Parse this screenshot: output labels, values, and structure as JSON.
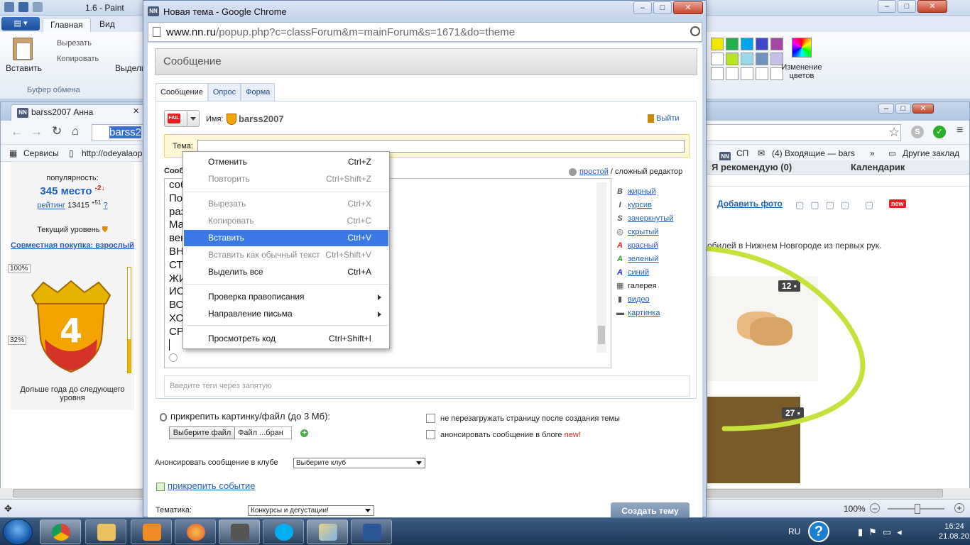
{
  "paint": {
    "title": "1.6 - Paint",
    "menu_label": "",
    "tabs": [
      "Главная",
      "Вид"
    ],
    "cut": "Вырезать",
    "copy": "Копировать",
    "paste": "Вставить",
    "select": "Выдели",
    "clipboard_group": "Буфер обмена",
    "edit_colors": "Изменение цветов",
    "palette": [
      "#f2e600",
      "#22b14c",
      "#00a2e8",
      "#3f48cc",
      "#a349a4",
      "#ffffff",
      "#b5e61d",
      "#99d9ea",
      "#7092be",
      "#c8bfe7",
      "#ffffff",
      "#ffffff",
      "#ffffff",
      "#ffffff",
      "#ffffff"
    ],
    "zoom": "100%"
  },
  "browser": {
    "tab_title": "barss2007 Анна",
    "url_selected": "barss2",
    "bookmarks": {
      "services": "Сервисы",
      "odeyalo": "http://odeyalaop",
      "nn": "СП",
      "inbox": "(4) Входящие — bars",
      "other": "Другие заклад"
    },
    "left": {
      "popularity_label": "популярность:",
      "rank": "345 место",
      "rank_delta": "-2↓",
      "rating_link": "рейтинг",
      "rating_value": "13415",
      "rating_delta": "+51",
      "rating_q": "?",
      "level_label": "Текущий уровень",
      "joint": "Совместная покупка: взрослый",
      "pct_top": "100%",
      "pct_fill": "32%",
      "fill_fraction": 0.32,
      "shield_level": "4",
      "next_level": "Дольше года до следующего уровня"
    },
    "right": {
      "recommend": "Я рекомендую (0)",
      "calendar": "Календарик",
      "add_photo": "Добавить фото",
      "new_badge": "new",
      "cars_text": "обилей в Нижнем Новгороде из первых рук.",
      "count1": "12",
      "count2": "27"
    }
  },
  "popup": {
    "window_title": "Новая тема - Google Chrome",
    "url_host": "www.nn.ru",
    "url_path": "/popup.php?c=classForum&m=mainForum&s=1671&do=theme",
    "header": "Сообщение",
    "tabs": [
      "Сообщение",
      "Опрос",
      "Форма"
    ],
    "name_label": "Имя:",
    "user_name": "barss2007",
    "logout": "Выйти",
    "topic_label": "Тема:",
    "topic_value": "",
    "message_label": "Сооб",
    "editor_simple": "простой",
    "editor_complex": " / сложный редактор",
    "text_lines": [
      "соб                                             ное обновление.",
      "По                                              . Снимает отечность лица. Позволяет",
      "раз                                              упредить появление новых!!!",
      "Ма                                              шает упругость и эластичность кожи",
      "век                                              ые круги!!!",
      "ВН                                              АККУРАТНО ОБРЕЗАЕТЕ С ОДНОЙ",
      "СТ                                              КУ, ОНА СИЛИКОНОВАЯ,",
      "ЖИ                                              НЕ СЛИВАЕМ, ПОСЛЕ",
      "ИС                                              ЕЕ СПОЛАСКИВАЕМ ЧИСТОЙ",
      "ВО                                              С ЖИДКОСТЬЮ И В",
      "ХО                                              СТЬ ЖИДКОСТЬ В УПАКОВКЕ В",
      "СР"
    ],
    "formats": [
      {
        "icon": "B",
        "label": "жирный",
        "link": true
      },
      {
        "icon": "I",
        "label": "курсив",
        "link": true
      },
      {
        "icon": "S",
        "label": "зачеркнутый",
        "link": true
      },
      {
        "icon": "◎",
        "label": "скрытый",
        "link": true
      },
      {
        "icon": "A",
        "label": "красный",
        "link": true,
        "color": "#d22"
      },
      {
        "icon": "A",
        "label": "зеленый",
        "link": true,
        "color": "#2a2"
      },
      {
        "icon": "A",
        "label": "синий",
        "link": true,
        "color": "#22c"
      },
      {
        "icon": "▦",
        "label": "галерея",
        "link": false
      },
      {
        "icon": "▮",
        "label": "видео",
        "link": true
      },
      {
        "icon": "▬",
        "label": "картинка",
        "link": true
      }
    ],
    "tags_placeholder": "Введите теги через запятую",
    "attach_label": "прикрепить картинку/файл (до 3 Мб):",
    "file_button": "Выберите файл",
    "file_name": "Файл ...бран",
    "no_reload": "не перезагружать страницу после создания темы",
    "announce_blog": "анонсировать сообщение в блоге ",
    "announce_new": "new!",
    "announce_club_label": "Анонсировать сообщение в клубе",
    "club_select": "Выберите клуб",
    "attach_event": "прикрепить событие",
    "theme_label": "Тематика:",
    "theme_select": "Конкурсы и дегустации!",
    "create_button": "Создать тему"
  },
  "context_menu": {
    "items": [
      {
        "label": "Отменить",
        "shortcut": "Ctrl+Z",
        "disabled": false
      },
      {
        "label": "Повторить",
        "shortcut": "Ctrl+Shift+Z",
        "disabled": true
      },
      {
        "label": "Вырезать",
        "shortcut": "Ctrl+X",
        "disabled": true
      },
      {
        "label": "Копировать",
        "shortcut": "Ctrl+C",
        "disabled": true
      },
      {
        "label": "Вставить",
        "shortcut": "Ctrl+V",
        "disabled": false,
        "highlight": true
      },
      {
        "label": "Вставить как обычный текст",
        "shortcut": "Ctrl+Shift+V",
        "disabled": true
      },
      {
        "label": "Выделить все",
        "shortcut": "Ctrl+A",
        "disabled": false
      },
      {
        "label": "Проверка правописания",
        "shortcut": "",
        "disabled": false,
        "submenu": true
      },
      {
        "label": "Направление письма",
        "shortcut": "",
        "disabled": false,
        "submenu": true
      },
      {
        "label": "Просмотреть код",
        "shortcut": "Ctrl+Shift+I",
        "disabled": false
      }
    ]
  },
  "taskbar": {
    "lang": "RU",
    "time": "16:24",
    "date": "21.08.2016",
    "help": "?"
  },
  "colors": {
    "accent": "#3b78e7",
    "link": "#1e62b8",
    "highlight_green": "#c5e23a"
  }
}
